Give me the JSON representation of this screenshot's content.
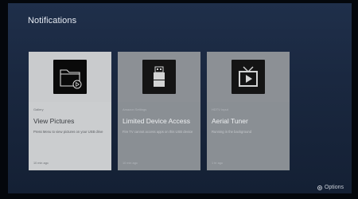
{
  "header": {
    "title": "Notifications"
  },
  "notifications": [
    {
      "source": "Gallery",
      "title": "View Pictures",
      "description": "Press Menu to view pictures on your USB drive",
      "time": "10 min ago",
      "icon": "folder-play-icon",
      "state": "focused"
    },
    {
      "source": "Amazon Settings",
      "title": "Limited Device Access",
      "description": "Fire TV cannot access apps on this USB device",
      "time": "10 min ago",
      "icon": "usb-drive-icon",
      "state": "unfocused"
    },
    {
      "source": "HDTV Input",
      "title": "Aerial Tuner",
      "description": "Running in the background",
      "time": "1 hr ago",
      "icon": "tv-play-icon",
      "state": "unfocused"
    }
  ],
  "footer": {
    "options_label": "Options",
    "options_icon": "options-button-icon"
  },
  "colors": {
    "background": "#1a2840",
    "focused_card": "#cbcdcf",
    "unfocused_card": "#8a8f94"
  }
}
